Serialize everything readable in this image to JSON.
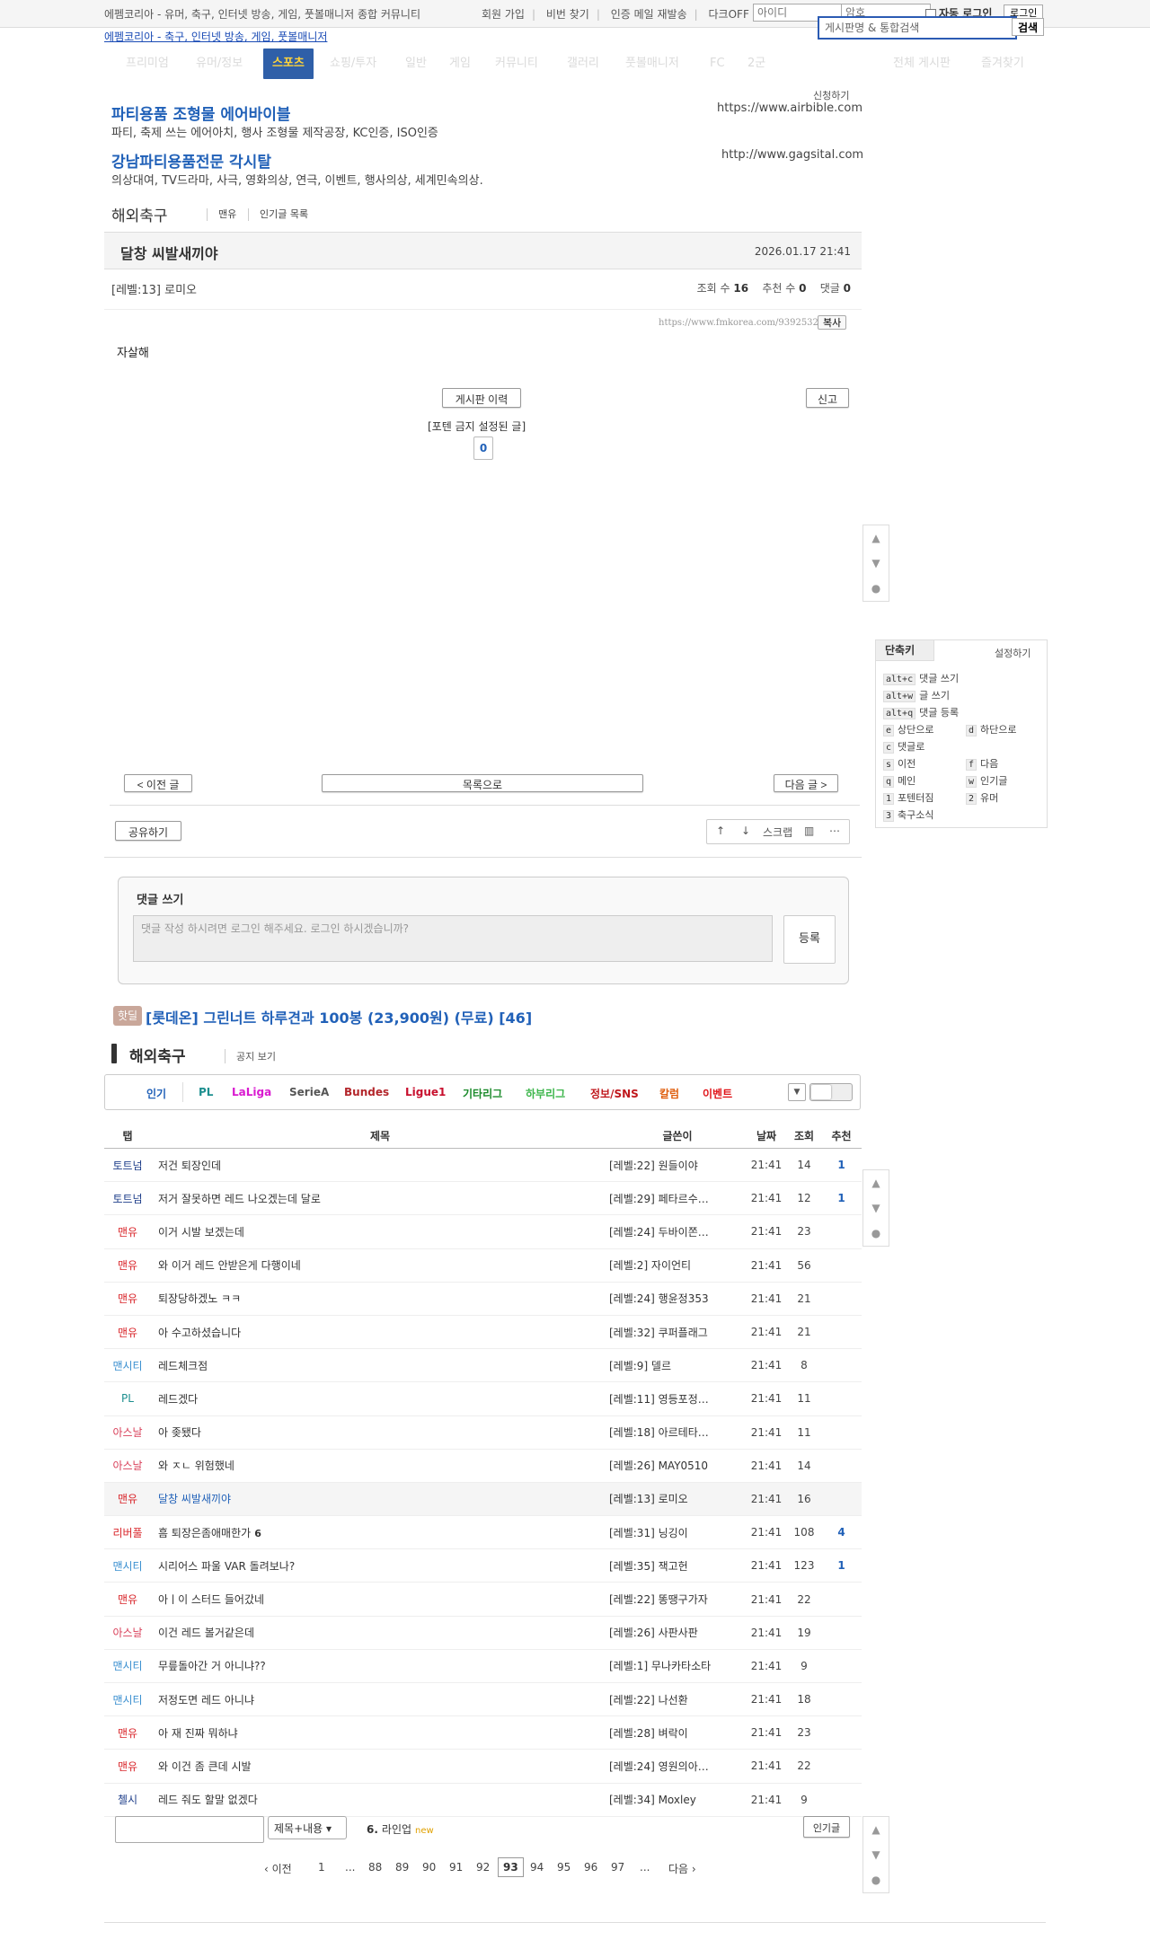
{
  "topbar": {
    "tagline": "에펨코리아 - 유머, 축구, 인터넷 방송, 게임, 풋볼매니저 종합 커뮤니티",
    "links": [
      "회원 가입",
      "비번 찾기",
      "인증 메일 재발송",
      "다크OFF"
    ],
    "id_placeholder": "아이디",
    "pw_placeholder": "암호",
    "auto_login": "자동 로그인",
    "login_button": "로그인"
  },
  "header": {
    "logo_text": "에펨코리아 - 축구, 인터넷 방송, 게임, 풋볼매니저",
    "search_placeholder": "게시판명 & 통합검색",
    "search_button": "검색"
  },
  "menu": {
    "items": [
      "프리미엄",
      "유머/정보",
      "스포츠",
      "쇼핑/투자",
      "일반",
      "게임",
      "커뮤니티",
      "갤러리",
      "풋볼매니저",
      "FC",
      "2군",
      "전체 게시판",
      "즐겨찾기"
    ],
    "active": "스포츠"
  },
  "ads": {
    "apply": "신청하기",
    "items": [
      {
        "title": "파티용품 조형물 에어바이블",
        "desc": "파티, 축제 쓰는 에어아치, 행사 조형물 제작공장, KC인증, ISO인증",
        "url": "https://www.airbible.com"
      },
      {
        "title": "강남파티용품전문 각시탈",
        "desc": "의상대여, TV드라마, 사극, 영화의상, 연극, 이벤트, 행사의상, 세계민속의상.",
        "url": "http://www.gagsital.com"
      }
    ]
  },
  "board": {
    "title": "해외축구",
    "tabs": [
      "맨유",
      "인기글 목록"
    ]
  },
  "post": {
    "title": "달창 씨발새끼야",
    "date": "2026.01.17 21:41",
    "author": "[레벨:13] 로미오",
    "views_label": "조회 수",
    "views": "16",
    "recs_label": "추천 수",
    "recs": "0",
    "comments_label": "댓글",
    "comments": "0",
    "url": "https://www.fmkorea.com/9392532583",
    "copy_label": "복사",
    "body": "자살해",
    "history_button": "게시판 이력",
    "report_button": "신고",
    "ban_note": "[포텐 금지 설정된 글]",
    "rec_count": "0"
  },
  "shortcuts": {
    "title": "단축키",
    "setting": "설정하기",
    "items": [
      {
        "key": "alt+c",
        "label": "댓글 쓰기"
      },
      {
        "key": "alt+w",
        "label": "글 쓰기"
      },
      {
        "key": "alt+q",
        "label": "댓글 등록"
      },
      {
        "key": "e",
        "label": "상단으로"
      },
      {
        "key": "d",
        "label": "하단으로"
      },
      {
        "key": "c",
        "label": "댓글로"
      },
      {
        "key": "s",
        "label": "이전"
      },
      {
        "key": "f",
        "label": "다음"
      },
      {
        "key": "q",
        "label": "메인"
      },
      {
        "key": "w",
        "label": "인기글"
      },
      {
        "key": "1",
        "label": "포텐터짐"
      },
      {
        "key": "2",
        "label": "유머"
      },
      {
        "key": "3",
        "label": "축구소식"
      }
    ]
  },
  "nav": {
    "prev": "< 이전 글",
    "list": "목록으로",
    "next": "다음 글 >",
    "share": "공유하기",
    "scrap": "스크랩"
  },
  "comment": {
    "label": "댓글 쓰기",
    "placeholder": "댓글 작성 하시려면 로그인 해주세요. 로그인 하시겠습니까?",
    "submit": "등록"
  },
  "hotdeal": {
    "badge": "핫딜",
    "title": "[롯데온] 그린너트 하루견과 100봉 (23,900원) (무료) [46]"
  },
  "list": {
    "title": "해외축구",
    "notice": "공지 보기",
    "categories": [
      {
        "label": "인기",
        "color": "#2161b8"
      },
      {
        "label": "PL",
        "color": "#1d8f8f"
      },
      {
        "label": "LaLiga",
        "color": "#d91ad0"
      },
      {
        "label": "SerieA",
        "color": "#555555"
      },
      {
        "label": "Bundes",
        "color": "#b3262b"
      },
      {
        "label": "Ligue1",
        "color": "#c8102e"
      },
      {
        "label": "기타리그",
        "color": "#1a8a2a"
      },
      {
        "label": "하부리그",
        "color": "#3bb54a"
      },
      {
        "label": "정보/SNS",
        "color": "#c0181d"
      },
      {
        "label": "칼럼",
        "color": "#e06010"
      },
      {
        "label": "이벤트",
        "color": "#e0151a"
      }
    ],
    "columns": [
      "탭",
      "제목",
      "글쓴이",
      "날짜",
      "조회",
      "추천"
    ],
    "rows": [
      {
        "tab": "토트넘",
        "color": "#1f3f8a",
        "title": "저건 퇴장인데",
        "author": "[레벨:22] 원들이야",
        "time": "21:41",
        "views": "14",
        "rec": "1"
      },
      {
        "tab": "토트넘",
        "color": "#1f3f8a",
        "title": "저거 잘못하면 레드 나오겠는데 달로",
        "author": "[레벨:29] 페타르수…",
        "time": "21:41",
        "views": "12",
        "rec": "1"
      },
      {
        "tab": "맨유",
        "color": "#d9262b",
        "title": "이거 시발 보겠는데",
        "author": "[레벨:24] 두바이쫀…",
        "time": "21:41",
        "views": "23",
        "rec": ""
      },
      {
        "tab": "맨유",
        "color": "#d9262b",
        "title": "와 이거 레드 안받은게 다행이네",
        "author": "[레벨:2] 자이언티",
        "time": "21:41",
        "views": "56",
        "rec": ""
      },
      {
        "tab": "맨유",
        "color": "#d9262b",
        "title": "퇴장당하겠노 ㅋㅋ",
        "author": "[레벨:24] 행윤정353",
        "time": "21:41",
        "views": "21",
        "rec": ""
      },
      {
        "tab": "맨유",
        "color": "#d9262b",
        "title": "아 수고하셨습니다",
        "author": "[레벨:32] 쿠퍼플래그",
        "time": "21:41",
        "views": "21",
        "rec": ""
      },
      {
        "tab": "맨시티",
        "color": "#3a8fd0",
        "title": "레드체크점",
        "author": "[레벨:9] 델르",
        "time": "21:41",
        "views": "8",
        "rec": ""
      },
      {
        "tab": "PL",
        "color": "#1d8f8f",
        "title": "레드겠다",
        "author": "[레벨:11] 영등포정…",
        "time": "21:41",
        "views": "11",
        "rec": ""
      },
      {
        "tab": "아스날",
        "color": "#d9405a",
        "title": "아 좆됐다",
        "author": "[레벨:18] 아르테타…",
        "time": "21:41",
        "views": "11",
        "rec": ""
      },
      {
        "tab": "아스날",
        "color": "#d9405a",
        "title": "와 ㅈㄴ 위험했네",
        "author": "[레벨:26] MAY0510",
        "time": "21:41",
        "views": "14",
        "rec": ""
      },
      {
        "tab": "맨유",
        "color": "#d9262b",
        "title": "달창 씨발새끼야",
        "author": "[레벨:13] 로미오",
        "time": "21:41",
        "views": "16",
        "rec": "",
        "current": true
      },
      {
        "tab": "리버풀",
        "color": "#d9262b",
        "title": "흠 퇴장은좀애매한가",
        "comments": "6",
        "author": "[레벨:31] 닝깅이",
        "time": "21:41",
        "views": "108",
        "rec": "4"
      },
      {
        "tab": "맨시티",
        "color": "#3a8fd0",
        "title": "시리어스 파울 VAR 돌려보나?",
        "author": "[레벨:35] 잭고헌",
        "time": "21:41",
        "views": "123",
        "rec": "1"
      },
      {
        "tab": "맨유",
        "color": "#d9262b",
        "title": "아ㅣ이 스터드 들어갔네",
        "author": "[레벨:22] 똥땡구가자",
        "time": "21:41",
        "views": "22",
        "rec": ""
      },
      {
        "tab": "아스날",
        "color": "#d9405a",
        "title": "이건 레드 볼거같은데",
        "author": "[레벨:26] 사판사판",
        "time": "21:41",
        "views": "19",
        "rec": ""
      },
      {
        "tab": "맨시티",
        "color": "#3a8fd0",
        "title": "무릎돌아간 거 아니냐??",
        "author": "[레벨:1] 무나카타소타",
        "time": "21:41",
        "views": "9",
        "rec": ""
      },
      {
        "tab": "맨시티",
        "color": "#3a8fd0",
        "title": "저정도면 레드 아니냐",
        "author": "[레벨:22] 나선환",
        "time": "21:41",
        "views": "18",
        "rec": ""
      },
      {
        "tab": "맨유",
        "color": "#d9262b",
        "title": "아 재 진짜 뭐하냐",
        "author": "[레벨:28] 벼락이",
        "time": "21:41",
        "views": "23",
        "rec": ""
      },
      {
        "tab": "맨유",
        "color": "#d9262b",
        "title": "와 이건 좀 큰데 시발",
        "author": "[레벨:24] 영원의아…",
        "time": "21:41",
        "views": "22",
        "rec": ""
      },
      {
        "tab": "첼시",
        "color": "#1f3f8a",
        "title": "레드 줘도 할말 없겠다",
        "author": "[레벨:34] Moxley",
        "time": "21:41",
        "views": "9",
        "rec": ""
      }
    ]
  },
  "bottom": {
    "select": "제목+내용",
    "lineup_num": "6.",
    "lineup": "라인업",
    "lineup_new": "new",
    "popular": "인기글",
    "pagination": {
      "prev": "‹ 이전",
      "pages": [
        "1",
        "...",
        "88",
        "89",
        "90",
        "91",
        "92",
        "93",
        "94",
        "95",
        "96",
        "97",
        "..."
      ],
      "current": "93",
      "next": "다음 ›"
    }
  }
}
